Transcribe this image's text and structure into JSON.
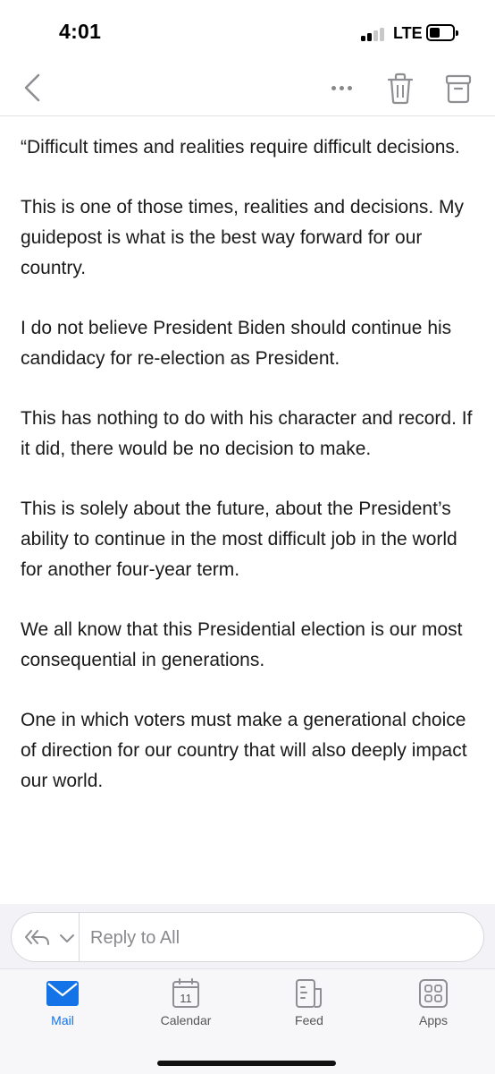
{
  "status_bar": {
    "time": "4:01",
    "network": "LTE",
    "signal_bars_active": 2,
    "signal_bars_total": 4,
    "battery_level": 0.35
  },
  "nav": {
    "back_icon": "chevron-left-icon",
    "more_icon": "ellipsis-icon",
    "delete_icon": "trash-icon",
    "archive_icon": "archive-icon"
  },
  "email": {
    "paragraphs": [
      "“Difficult times and realities require difficult decisions.",
      "This is one of those times, realities and decisions. My guidepost is what is the best way forward for our country.",
      "I do not believe President Biden should continue his candidacy for re-election as President.",
      "This has nothing to do with his character and record. If it did, there would be no decision to make.",
      "This is solely about the future, about the President’s ability to continue in the most difficult job in the world for another four-year term.",
      "We all know that this Presidential election is our most consequential in generations.",
      "One in which voters must make a generational choice of direction for our country that will also deeply impact our world."
    ]
  },
  "reply": {
    "placeholder": "Reply to All",
    "options_icon": "reply-all-icon"
  },
  "tabs": [
    {
      "label": "Mail",
      "icon": "mail-icon",
      "active": true
    },
    {
      "label": "Calendar",
      "icon": "calendar-icon",
      "day": "11",
      "active": false
    },
    {
      "label": "Feed",
      "icon": "feed-icon",
      "active": false
    },
    {
      "label": "Apps",
      "icon": "apps-icon",
      "active": false
    }
  ],
  "colors": {
    "accent": "#1473e6",
    "icon_gray": "#8e8e93"
  }
}
